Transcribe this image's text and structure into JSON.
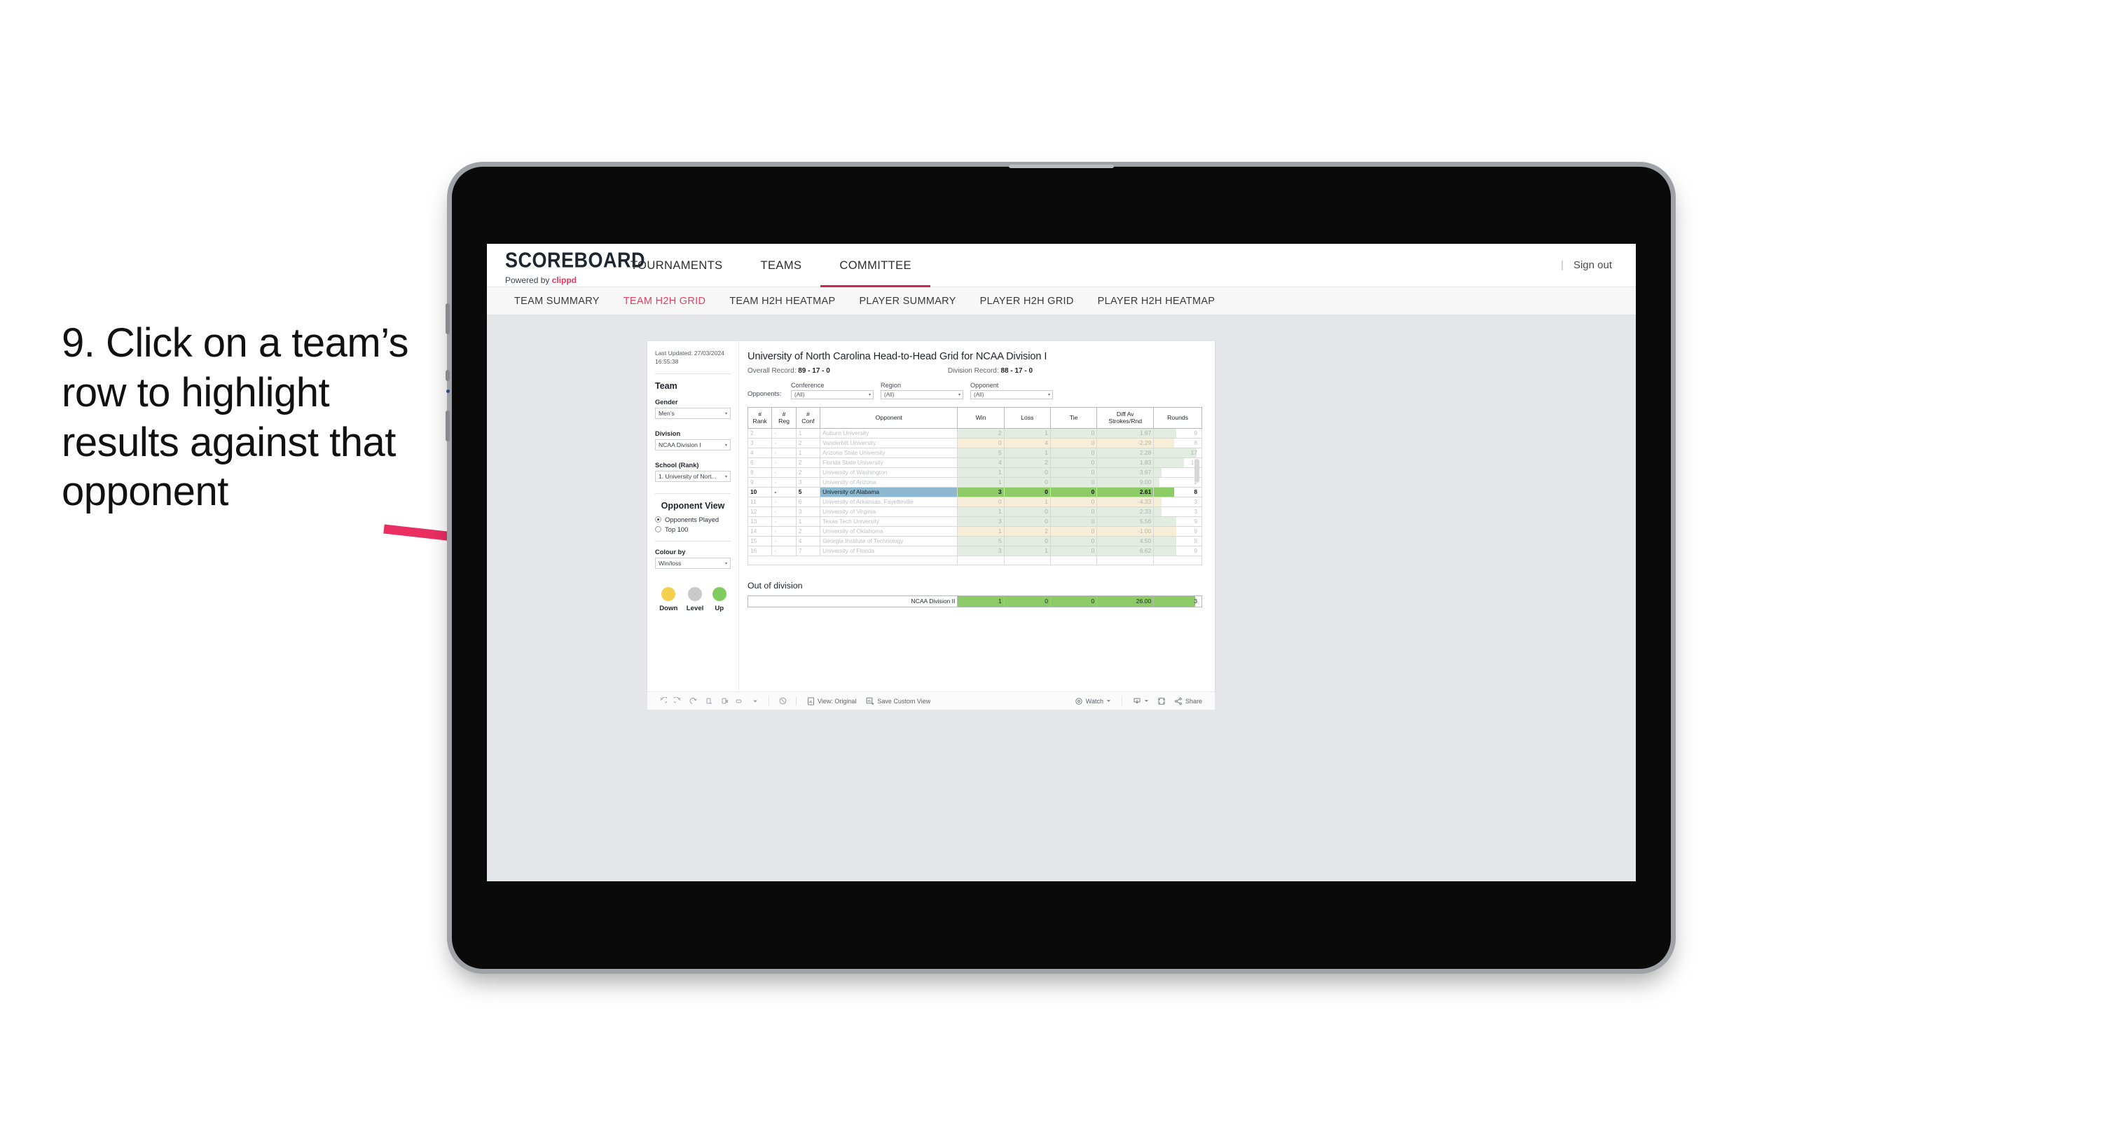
{
  "annotation": {
    "text": "9. Click on a team’s row to highlight results against that opponent",
    "arrow_color": "#ea2e62"
  },
  "app": {
    "brand": {
      "logo": "SCOREBOARD",
      "powered_prefix": "Powered by ",
      "powered_name": "clippd"
    },
    "top_nav": [
      {
        "label": "TOURNAMENTS",
        "active": false
      },
      {
        "label": "TEAMS",
        "active": false
      },
      {
        "label": "COMMITTEE",
        "active": true
      }
    ],
    "sign_out": "Sign out",
    "sub_nav": [
      {
        "label": "TEAM SUMMARY",
        "active": false
      },
      {
        "label": "TEAM H2H GRID",
        "active": true
      },
      {
        "label": "TEAM H2H HEATMAP",
        "active": false
      },
      {
        "label": "PLAYER SUMMARY",
        "active": false
      },
      {
        "label": "PLAYER H2H GRID",
        "active": false
      },
      {
        "label": "PLAYER H2H HEATMAP",
        "active": false
      }
    ]
  },
  "panel": {
    "last_updated": "Last Updated: 27/03/2024 16:55:38",
    "team_heading": "Team",
    "gender_label": "Gender",
    "gender_value": "Men’s",
    "division_label": "Division",
    "division_value": "NCAA Division I",
    "school_label": "School (Rank)",
    "school_value": "1. University of Nort...",
    "opponent_view_heading": "Opponent View",
    "opponent_view_options": [
      {
        "label": "Opponents Played",
        "selected": true
      },
      {
        "label": "Top 100",
        "selected": false
      }
    ],
    "colour_by_label": "Colour by",
    "colour_by_value": "Win/loss",
    "legend": [
      {
        "label": "Down",
        "color": "#f4d04e"
      },
      {
        "label": "Level",
        "color": "#c9c9c9"
      },
      {
        "label": "Up",
        "color": "#82cb5e"
      }
    ]
  },
  "report": {
    "title": "University of North Carolina Head-to-Head Grid for NCAA Division I",
    "overall_record_label": "Overall Record: ",
    "overall_record_value": "89 - 17 - 0",
    "division_record_label": "Division Record: ",
    "division_record_value": "88 - 17 - 0",
    "opponents_lead": "Opponents:",
    "filters": [
      {
        "label": "Conference",
        "value": "(All)"
      },
      {
        "label": "Region",
        "value": "(All)"
      },
      {
        "label": "Opponent",
        "value": "(All)"
      }
    ],
    "out_of_division_title": "Out of division",
    "out_of_division_row": {
      "name": "NCAA Division II",
      "win": "1",
      "loss": "0",
      "tie": "0",
      "diff": "26.00",
      "rounds": "3",
      "color": "#8ccb66",
      "rounds_fill_pct": 86
    }
  },
  "chart_data": {
    "type": "table",
    "title": "University of North Carolina Head-to-Head Grid for NCAA Division I",
    "columns": [
      "# Rank",
      "# Reg",
      "# Conf",
      "Opponent",
      "Win",
      "Loss",
      "Tie",
      "Diff Av Strokes/Rnd",
      "Rounds"
    ],
    "column_headers_multiline": [
      {
        "l1": "#",
        "l2": "Rank"
      },
      {
        "l1": "#",
        "l2": "Reg"
      },
      {
        "l1": "#",
        "l2": "Conf"
      },
      {
        "l1": "Opponent",
        "l2": ""
      },
      {
        "l1": "Win",
        "l2": ""
      },
      {
        "l1": "Loss",
        "l2": ""
      },
      {
        "l1": "Tie",
        "l2": ""
      },
      {
        "l1": "Diff Av",
        "l2": "Strokes/Rnd"
      },
      {
        "l1": "Rounds",
        "l2": ""
      }
    ],
    "rows": [
      {
        "rank": "2",
        "reg": "-",
        "conf": "1",
        "opponent": "Auburn University",
        "win": "2",
        "loss": "1",
        "tie": "0",
        "diff": "1.67",
        "rounds": "9",
        "state": "up",
        "selected": false,
        "rounds_pct": 47
      },
      {
        "rank": "3",
        "reg": "-",
        "conf": "2",
        "opponent": "Vanderbilt University",
        "win": "0",
        "loss": "4",
        "tie": "0",
        "diff": "-2.29",
        "rounds": "8",
        "state": "down",
        "selected": false,
        "rounds_pct": 42
      },
      {
        "rank": "4",
        "reg": "-",
        "conf": "1",
        "opponent": "Arizona State University",
        "win": "5",
        "loss": "1",
        "tie": "0",
        "diff": "2.28",
        "rounds": "17",
        "state": "up",
        "selected": false,
        "rounds_pct": 89
      },
      {
        "rank": "6",
        "reg": "-",
        "conf": "2",
        "opponent": "Florida State University",
        "win": "4",
        "loss": "2",
        "tie": "0",
        "diff": "1.83",
        "rounds": "12",
        "state": "up",
        "selected": false,
        "rounds_pct": 63
      },
      {
        "rank": "8",
        "reg": "-",
        "conf": "2",
        "opponent": "University of Washington",
        "win": "1",
        "loss": "0",
        "tie": "0",
        "diff": "3.67",
        "rounds": "3",
        "state": "up",
        "selected": false,
        "rounds_pct": 16
      },
      {
        "rank": "9",
        "reg": "-",
        "conf": "3",
        "opponent": "University of Arizona",
        "win": "1",
        "loss": "0",
        "tie": "0",
        "diff": "9.00",
        "rounds": "2",
        "state": "up",
        "selected": false,
        "rounds_pct": 11
      },
      {
        "rank": "10",
        "reg": "-",
        "conf": "5",
        "opponent": "University of Alabama",
        "win": "3",
        "loss": "0",
        "tie": "0",
        "diff": "2.61",
        "rounds": "8",
        "state": "up",
        "selected": true,
        "rounds_pct": 42
      },
      {
        "rank": "11",
        "reg": "-",
        "conf": "6",
        "opponent": "University of Arkansas, Fayetteville",
        "win": "0",
        "loss": "1",
        "tie": "0",
        "diff": "-4.33",
        "rounds": "3",
        "state": "down",
        "selected": false,
        "rounds_pct": 16
      },
      {
        "rank": "12",
        "reg": "-",
        "conf": "3",
        "opponent": "University of Virginia",
        "win": "1",
        "loss": "0",
        "tie": "0",
        "diff": "2.33",
        "rounds": "3",
        "state": "up",
        "selected": false,
        "rounds_pct": 16
      },
      {
        "rank": "13",
        "reg": "-",
        "conf": "1",
        "opponent": "Texas Tech University",
        "win": "3",
        "loss": "0",
        "tie": "0",
        "diff": "5.56",
        "rounds": "9",
        "state": "up",
        "selected": false,
        "rounds_pct": 47
      },
      {
        "rank": "14",
        "reg": "-",
        "conf": "2",
        "opponent": "University of Oklahoma",
        "win": "1",
        "loss": "2",
        "tie": "0",
        "diff": "-1.00",
        "rounds": "9",
        "state": "down",
        "selected": false,
        "rounds_pct": 47
      },
      {
        "rank": "15",
        "reg": "-",
        "conf": "4",
        "opponent": "Georgia Institute of Technology",
        "win": "5",
        "loss": "0",
        "tie": "0",
        "diff": "4.50",
        "rounds": "9",
        "state": "up",
        "selected": false,
        "rounds_pct": 47
      },
      {
        "rank": "16",
        "reg": "-",
        "conf": "7",
        "opponent": "University of Florida",
        "win": "3",
        "loss": "1",
        "tie": "0",
        "diff": "6.62",
        "rounds": "9",
        "state": "up",
        "selected": false,
        "rounds_pct": 47
      }
    ],
    "colors": {
      "up_dim": "#e3ece0",
      "down_dim": "#f6eed8",
      "up_selected": "#8ccb66",
      "selected_opponent": "#8cb8d0"
    }
  },
  "toolbar": {
    "view_label": "View: Original",
    "save_label": "Save Custom View",
    "watch_label": "Watch",
    "share_label": "Share"
  }
}
